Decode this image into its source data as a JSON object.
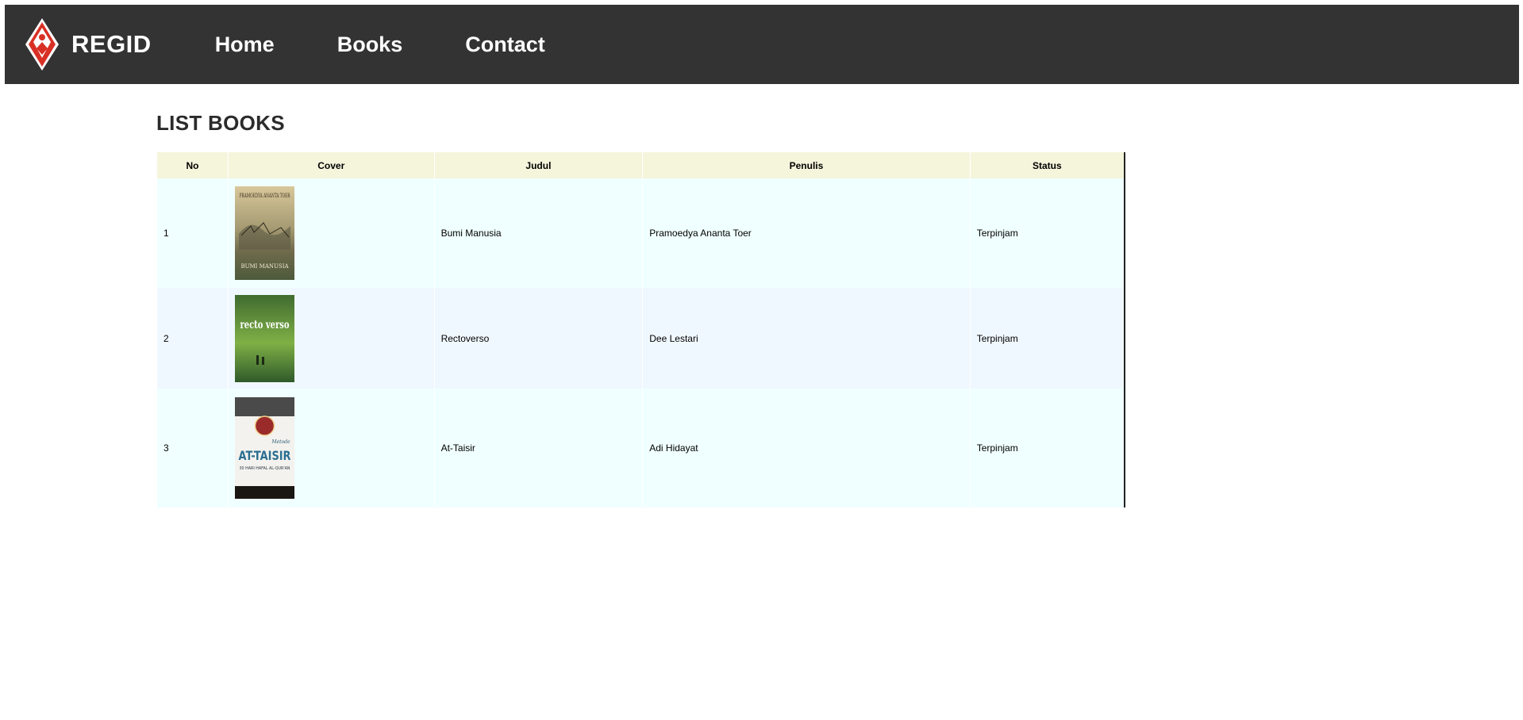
{
  "navbar": {
    "brand": "REGID",
    "logo_icon": "regid-logo-icon",
    "links": [
      "Home",
      "Books",
      "Contact"
    ],
    "bg_color": "#333333"
  },
  "page": {
    "title": "LIST BOOKS"
  },
  "table": {
    "headers": [
      "No",
      "Cover",
      "Judul",
      "Penulis",
      "Status"
    ],
    "rows": [
      {
        "no": "1",
        "cover_title": "BUMI MANUSIA",
        "cover_author": "PRAMOEDYA ANANTA TOER",
        "judul": "Bumi Manusia",
        "penulis": "Pramoedya Ananta Toer",
        "status": "Terpinjam"
      },
      {
        "no": "2",
        "cover_title": "recto verso",
        "judul": "Rectoverso",
        "penulis": "Dee Lestari",
        "status": "Terpinjam"
      },
      {
        "no": "3",
        "cover_title": "AT-TAISIR",
        "cover_subtitle": "30 HARI HAFAL AL-QUR'AN",
        "cover_kicker": "Metode",
        "judul": "At-Taisir",
        "penulis": "Adi Hidayat",
        "status": "Terpinjam"
      }
    ],
    "header_bg": "#f5f5dc",
    "row_odd_bg": "#f0ffff",
    "row_even_bg": "#f0f8ff"
  }
}
